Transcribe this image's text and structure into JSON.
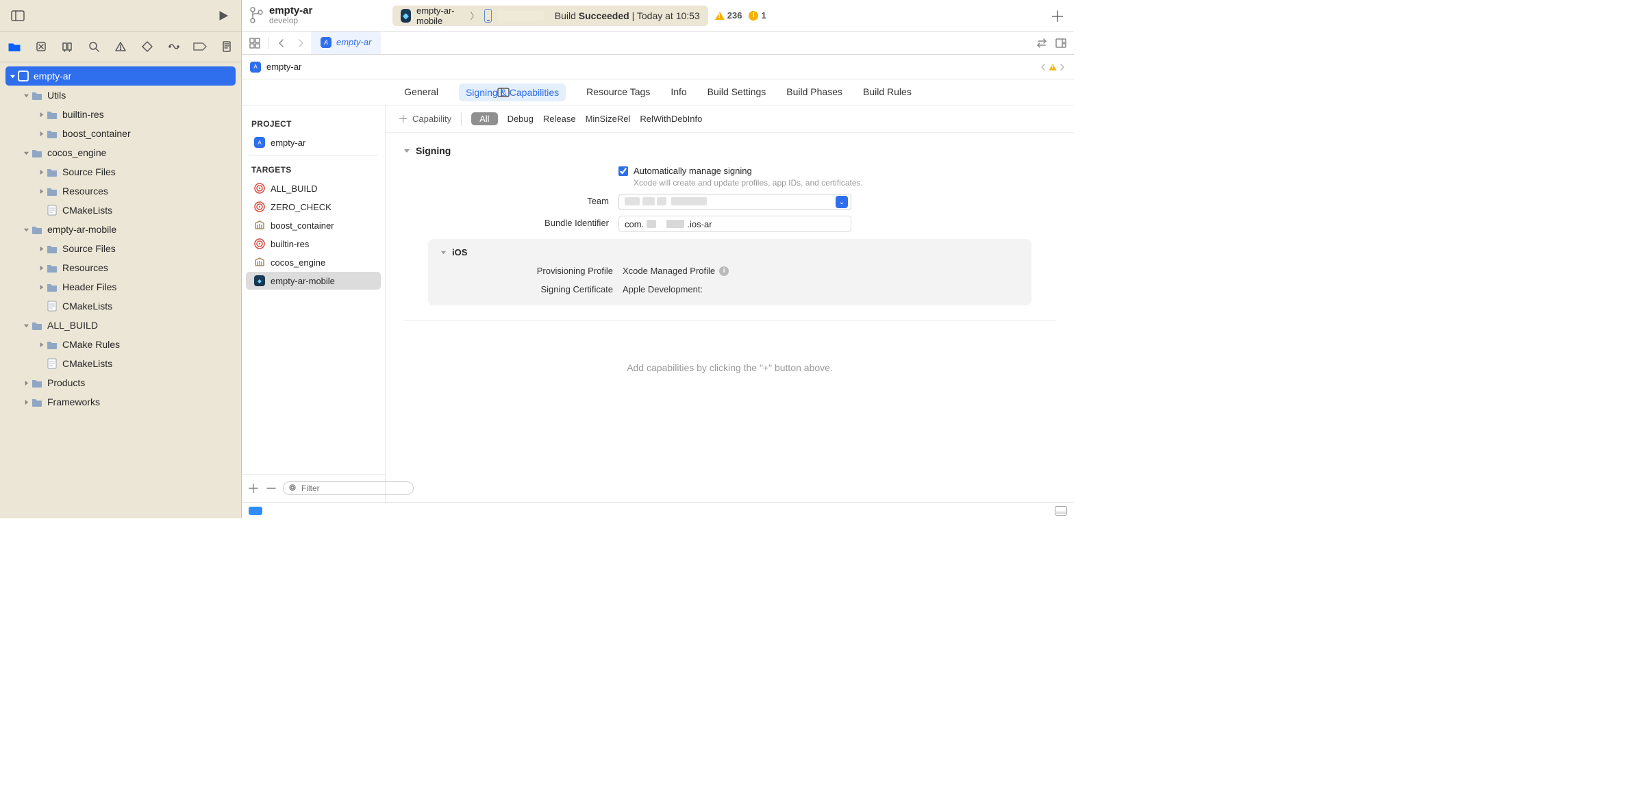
{
  "project": {
    "name": "empty-ar",
    "branch": "develop"
  },
  "scheme": {
    "target": "empty-ar-mobile",
    "device": ""
  },
  "status": {
    "build_word": "Build",
    "result": "Succeeded",
    "time_prefix": "Today at",
    "time": "10:53",
    "warnings": 236,
    "errors": 1
  },
  "navigator": {
    "root": "empty-ar",
    "items": [
      {
        "d": 1,
        "icon": "folder",
        "label": "Utils",
        "open": true
      },
      {
        "d": 2,
        "icon": "folder",
        "label": "builtin-res",
        "open": false
      },
      {
        "d": 2,
        "icon": "folder",
        "label": "boost_container",
        "open": false
      },
      {
        "d": 1,
        "icon": "folder",
        "label": "cocos_engine",
        "open": true
      },
      {
        "d": 2,
        "icon": "folder",
        "label": "Source Files",
        "open": false
      },
      {
        "d": 2,
        "icon": "folder",
        "label": "Resources",
        "open": false
      },
      {
        "d": 2,
        "icon": "file",
        "label": "CMakeLists",
        "open": null
      },
      {
        "d": 1,
        "icon": "folder",
        "label": "empty-ar-mobile",
        "open": true
      },
      {
        "d": 2,
        "icon": "folder",
        "label": "Source Files",
        "open": false
      },
      {
        "d": 2,
        "icon": "folder",
        "label": "Resources",
        "open": false
      },
      {
        "d": 2,
        "icon": "folder",
        "label": "Header Files",
        "open": false
      },
      {
        "d": 2,
        "icon": "file",
        "label": "CMakeLists",
        "open": null
      },
      {
        "d": 1,
        "icon": "folder",
        "label": "ALL_BUILD",
        "open": true
      },
      {
        "d": 2,
        "icon": "folder",
        "label": "CMake Rules",
        "open": false
      },
      {
        "d": 2,
        "icon": "file",
        "label": "CMakeLists",
        "open": null
      },
      {
        "d": 1,
        "icon": "folder",
        "label": "Products",
        "open": false
      },
      {
        "d": 1,
        "icon": "folder",
        "label": "Frameworks",
        "open": false
      }
    ]
  },
  "editor_tab": {
    "title": "empty-ar"
  },
  "breadcrumb": {
    "title": "empty-ar"
  },
  "settings_tabs": [
    "General",
    "Signing & Capabilities",
    "Resource Tags",
    "Info",
    "Build Settings",
    "Build Phases",
    "Build Rules"
  ],
  "settings_active": 1,
  "targets_pane": {
    "project_label": "PROJECT",
    "project_item": "empty-ar",
    "targets_label": "TARGETS",
    "targets": [
      {
        "icon": "bulls",
        "label": "ALL_BUILD"
      },
      {
        "icon": "bulls",
        "label": "ZERO_CHECK"
      },
      {
        "icon": "lib",
        "label": "boost_container"
      },
      {
        "icon": "bulls",
        "label": "builtin-res"
      },
      {
        "icon": "lib",
        "label": "cocos_engine"
      },
      {
        "icon": "bundle",
        "label": "empty-ar-mobile"
      }
    ],
    "selected": 5,
    "filter_placeholder": "Filter"
  },
  "capability_bar": {
    "add_label": "Capability",
    "all_label": "All",
    "configs": [
      "Debug",
      "Release",
      "MinSizeRel",
      "RelWithDebInfo"
    ]
  },
  "signing_section": {
    "title": "Signing",
    "auto_label": "Automatically manage signing",
    "auto_checked": true,
    "auto_hint": "Xcode will create and update profiles, app IDs, and certificates.",
    "team_label": "Team",
    "bundle_label": "Bundle Identifier",
    "bundle_value_prefix": "com.",
    "bundle_value_suffix": ".ios-ar"
  },
  "platform_section": {
    "title": "iOS",
    "provisioning_label": "Provisioning Profile",
    "provisioning_value": "Xcode Managed Profile",
    "cert_label": "Signing Certificate",
    "cert_value": "Apple Development:"
  },
  "empty_hint": "Add capabilities by clicking the \"+\" button above."
}
